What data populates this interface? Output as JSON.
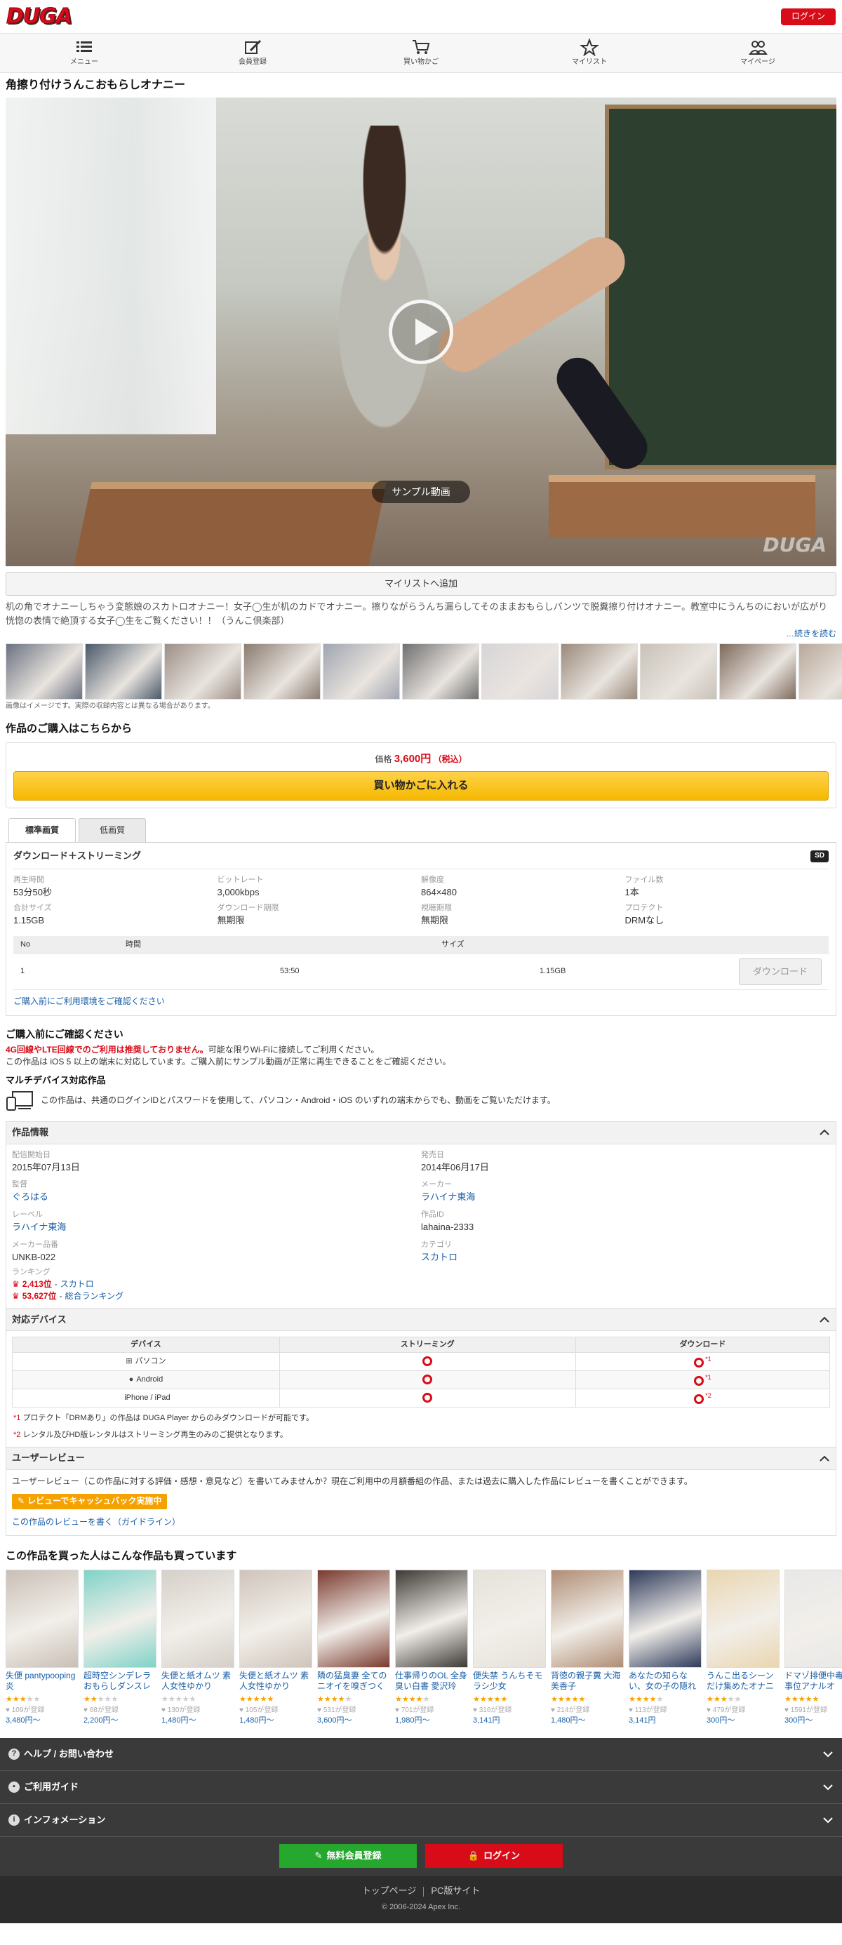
{
  "header": {
    "logo": "DUGA",
    "login": "ログイン"
  },
  "nav": [
    {
      "label": "メニュー",
      "icon": "menu-icon"
    },
    {
      "label": "会員登録",
      "icon": "register-icon"
    },
    {
      "label": "買い物かご",
      "icon": "cart-icon"
    },
    {
      "label": "マイリスト",
      "icon": "star-icon"
    },
    {
      "label": "マイページ",
      "icon": "users-icon"
    }
  ],
  "title": "角擦り付けうんこおもらしオナニー",
  "player": {
    "sample_label": "サンプル動画",
    "watermark": "DUGA"
  },
  "mylist_btn": "マイリストへ追加",
  "description": "机の角でオナニーしちゃう変態娘のスカトロオナニー！女子◯生が机のカドでオナニー。擦りながらうんち漏らしてそのままおもらしパンツで脱糞擦り付けオナニー。教室中にうんちのにおいが広がり恍惚の表情で絶頂する女子◯生をご覧ください！！（うんこ倶楽部）",
  "readmore": "…続きを読む",
  "thumb_note": "画像はイメージです。実際の収録内容とは異なる場合があります。",
  "purchase": {
    "heading": "作品のご購入はこちらから",
    "price_label": "価格",
    "price": "3,600円",
    "tax": "（税込）",
    "cart_btn": "買い物かごに入れる"
  },
  "tabs": [
    "標準画質",
    "低画質"
  ],
  "download": {
    "heading": "ダウンロード＋ストリーミング",
    "badge": "SD",
    "specs": [
      {
        "k": "再生時間",
        "v": "53分50秒"
      },
      {
        "k": "ビットレート",
        "v": "3,000kbps"
      },
      {
        "k": "解像度",
        "v": "864×480"
      },
      {
        "k": "ファイル数",
        "v": "1本"
      },
      {
        "k": "合計サイズ",
        "v": "1.15GB"
      },
      {
        "k": "ダウンロード期限",
        "v": "無期限"
      },
      {
        "k": "視聴期限",
        "v": "無期限"
      },
      {
        "k": "プロテクト",
        "v": "DRMなし"
      }
    ],
    "table_headers": [
      "No",
      "時間",
      "サイズ"
    ],
    "row": {
      "no": "1",
      "time": "53:50",
      "size": "1.15GB",
      "btn": "ダウンロード"
    },
    "env_link": "ご購入前にご利用環境をご確認ください"
  },
  "confirm": {
    "heading": "ご購入前にご確認ください",
    "warn": "4G回線やLTE回線でのご利用は推奨しておりません。",
    "warn_rest": "可能な限りWi-Fiに接続してご利用ください。",
    "ios": "この作品は iOS 5 以上の端末に対応しています。ご購入前にサンプル動画が正常に再生できることをご確認ください。",
    "multi_heading": "マルチデバイス対応作品",
    "multi_text": "この作品は、共通のログインIDとパスワードを使用して、パソコン・Android・iOS のいずれの端末からでも、動画をご覧いただけます。"
  },
  "info": {
    "heading": "作品情報",
    "items": [
      {
        "k": "配信開始日",
        "v": "2015年07月13日",
        "link": false
      },
      {
        "k": "発売日",
        "v": "2014年06月17日",
        "link": false
      },
      {
        "k": "監督",
        "v": "ぐろはる",
        "link": true
      },
      {
        "k": "メーカー",
        "v": "ラハイナ東海",
        "link": true
      },
      {
        "k": "レーベル",
        "v": "ラハイナ東海",
        "link": true
      },
      {
        "k": "作品ID",
        "v": "lahaina-2333",
        "link": false
      },
      {
        "k": "メーカー品番",
        "v": "UNKB-022",
        "link": false
      },
      {
        "k": "カテゴリ",
        "v": "スカトロ",
        "link": true
      }
    ],
    "ranking_label": "ランキング",
    "rank1": {
      "pos": "2,413位",
      "cat": "スカトロ"
    },
    "rank2": {
      "pos": "53,627位",
      "cat": "総合ランキング"
    }
  },
  "devices": {
    "heading": "対応デバイス",
    "cols": [
      "デバイス",
      "ストリーミング",
      "ダウンロード"
    ],
    "rows": [
      {
        "name": "パソコン",
        "icon": "windows-icon",
        "dl_note": "*1"
      },
      {
        "name": "Android",
        "icon": "android-icon",
        "dl_note": "*1"
      },
      {
        "name": "iPhone / iPad",
        "icon": "apple-icon",
        "dl_note": "*2"
      }
    ],
    "note1_mark": "*1",
    "note1": "プロテクト「DRMあり」の作品は DUGA Player からのみダウンロードが可能です。",
    "note2_mark": "*2",
    "note2": "レンタル及びHD版レンタルはストリーミング再生のみのご提供となります。"
  },
  "review": {
    "heading": "ユーザーレビュー",
    "text": "ユーザーレビュー（この作品に対する評価・感想・意見など）を書いてみませんか？現在ご利用中の月額番組の作品、または過去に購入した作品にレビューを書くことができます。",
    "badge": "レビューでキャッシュバック実施中",
    "link": "この作品のレビューを書く（ガイドライン）"
  },
  "also": {
    "heading": "この作品を買った人はこんな作品も買っています",
    "items": [
      {
        "title": "失便 pantypooping 炎",
        "stars": 3,
        "count": "109が登録",
        "price": "3,480円〜"
      },
      {
        "title": "超時空シンデレラおもらしダンスレ",
        "stars": 2,
        "count": "68が登録",
        "price": "2,200円〜"
      },
      {
        "title": "失便と紙オムツ 素人女性ゆかり",
        "stars": 0,
        "count": "130が登録",
        "price": "1,480円〜"
      },
      {
        "title": "失便と紙オムツ 素人女性ゆかり",
        "stars": 5,
        "count": "105が登録",
        "price": "1,480円〜"
      },
      {
        "title": "隣の猛臭妻 全ての ニオイを嗅ぎつく",
        "stars": 4,
        "count": "531が登録",
        "price": "3,600円〜"
      },
      {
        "title": "仕事帰りのOL 全身臭い白書 愛沢玲",
        "stars": 4,
        "count": "701が登録",
        "price": "1,980円〜"
      },
      {
        "title": "便失禁 うんちそモラシ少女",
        "stars": 5,
        "count": "316が登録",
        "price": "3,141円"
      },
      {
        "title": "背徳の親子糞 大海美香子",
        "stars": 5,
        "count": "214が登録",
        "price": "1,480円〜"
      },
      {
        "title": "あなたの知らない、女の子の隠れ",
        "stars": 4,
        "count": "113が登録",
        "price": "3,141円"
      },
      {
        "title": "うんこ出るシーンだけ集めたオナニ",
        "stars": 3,
        "count": "479が登録",
        "price": "300円〜"
      },
      {
        "title": "ドマゾ排便中毒 執事位アナルオ",
        "stars": 5,
        "count": "1591が登録",
        "price": "300円〜"
      }
    ]
  },
  "footer": {
    "acc": [
      {
        "label": "ヘルプ / お問い合わせ",
        "icon": "help-icon"
      },
      {
        "label": "ご利用ガイド",
        "icon": "guide-icon"
      },
      {
        "label": "インフォメーション",
        "icon": "info-icon"
      }
    ],
    "register": "無料会員登録",
    "login": "ログイン",
    "top": "トップページ",
    "pc": "PC版サイト",
    "copy": "© 2006-2024 Apex Inc."
  }
}
